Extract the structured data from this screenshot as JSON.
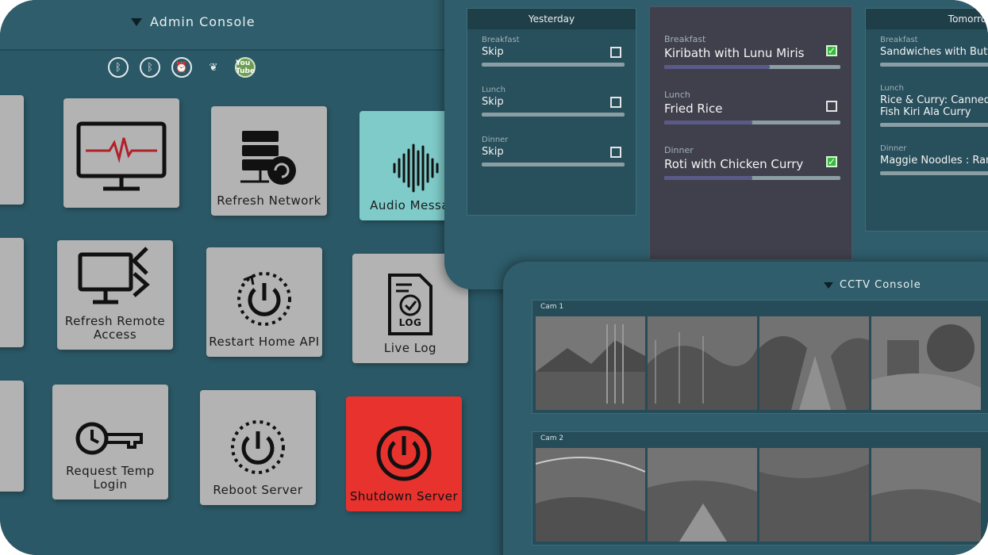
{
  "admin": {
    "title": "Admin Console",
    "toolbar": [
      {
        "icon": "bluetooth-off-icon",
        "glyph": "ᛒ"
      },
      {
        "icon": "bluetooth-off-icon",
        "glyph": "ᛒ"
      },
      {
        "icon": "alarm-clock-icon",
        "glyph": "⏰"
      },
      {
        "icon": "plant-icon",
        "glyph": "❦"
      },
      {
        "icon": "youtube-icon",
        "glyph": "You Tube"
      }
    ],
    "tiles": {
      "monitor": "",
      "refresh_network": "Refresh Network",
      "audio_message": "Audio Message",
      "refresh_remote_access": "Refresh Remote Access",
      "restart_home_api": "Restart Home API",
      "live_log": "Live Log",
      "live_log_icon_text": "LOG",
      "request_temp_login": "Request Temp Login",
      "reboot_server": "Reboot Server",
      "shutdown_server": "Shutdown Server"
    }
  },
  "meals": {
    "yesterday": {
      "header": "Yesterday",
      "items": [
        {
          "label": "Breakfast",
          "name": "Skip",
          "checked": false
        },
        {
          "label": "Lunch",
          "name": "Skip",
          "checked": false
        },
        {
          "label": "Dinner",
          "name": "Skip",
          "checked": false
        }
      ]
    },
    "today": {
      "header": "",
      "items": [
        {
          "label": "Breakfast",
          "name": "Kiribath with Lunu Miris",
          "checked": true,
          "progress": 0.6
        },
        {
          "label": "Lunch",
          "name": "Fried Rice",
          "checked": false,
          "progress": 0.5
        },
        {
          "label": "Dinner",
          "name": "Roti with Chicken Curry",
          "checked": true,
          "progress": 0.5
        }
      ]
    },
    "tomorrow": {
      "header": "Tomorrow",
      "items": [
        {
          "label": "Breakfast",
          "name": "Sandwiches with Butter"
        },
        {
          "label": "Lunch",
          "name": "Rice & Curry: Canned Fish Kiri Ala Curry"
        },
        {
          "label": "Dinner",
          "name": "Maggie Noodles : Ramen"
        }
      ]
    }
  },
  "cctv": {
    "title": "CCTV Console",
    "cams": [
      {
        "label": "Cam 1"
      },
      {
        "label": "Cam 2"
      }
    ]
  },
  "colors": {
    "background": "#2b5866",
    "tile": "#b3b3b3",
    "audio_tile": "#7ecbc9",
    "shutdown_tile": "#e8322e",
    "check_on": "#38b93b"
  }
}
